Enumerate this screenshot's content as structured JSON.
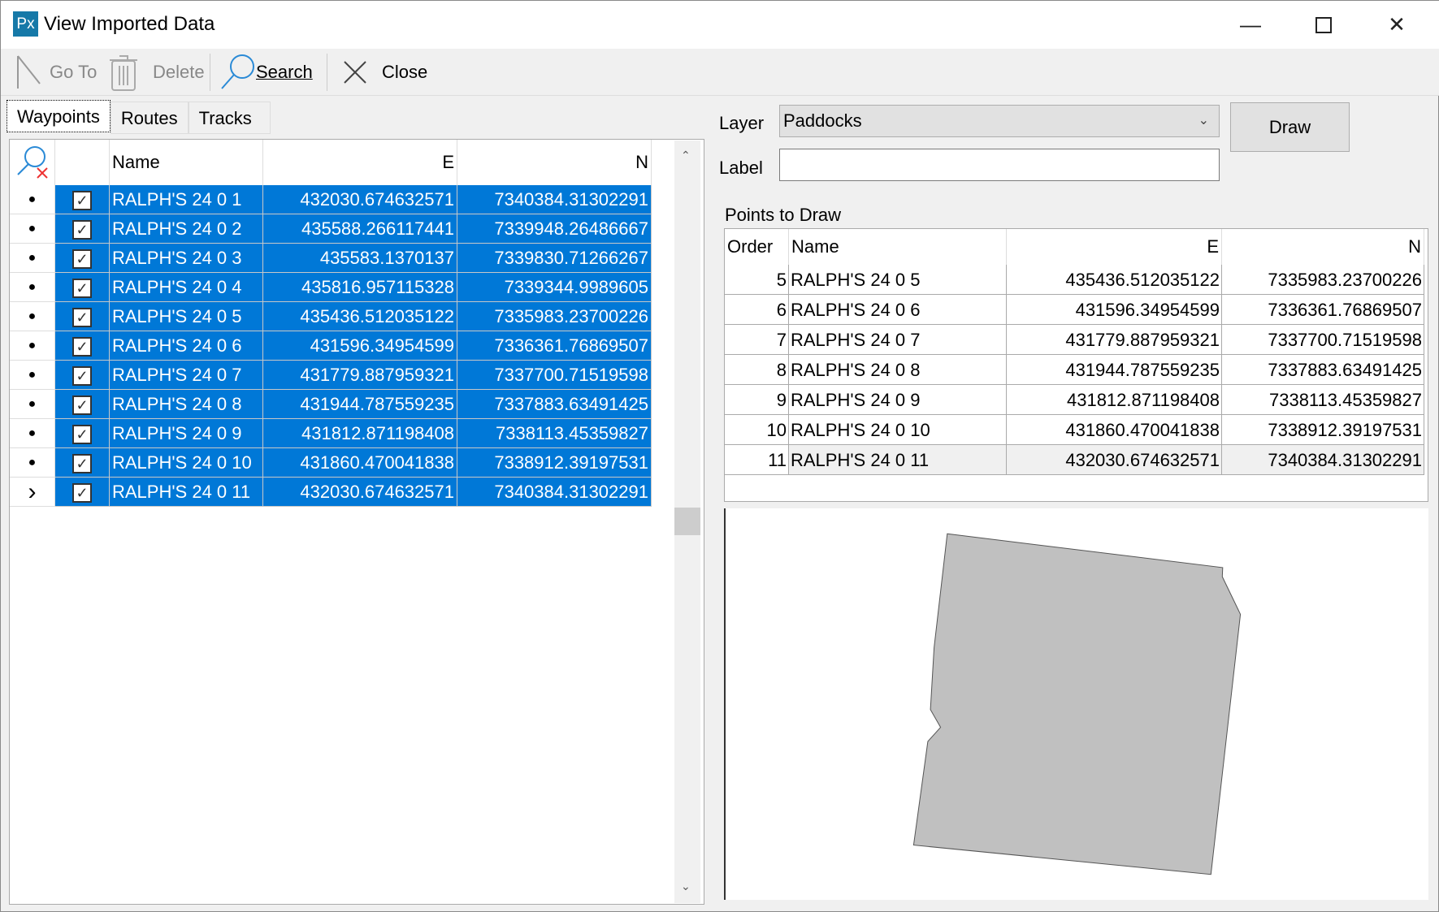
{
  "window": {
    "title": "View Imported Data",
    "app_icon": "Px",
    "controls": [
      "minimize-icon",
      "maximize-icon",
      "close-icon"
    ]
  },
  "toolbar": {
    "goto": "Go To",
    "delete": "Delete",
    "search": "Search",
    "close": "Close"
  },
  "tabs": [
    {
      "label": "Waypoints",
      "active": true
    },
    {
      "label": "Routes"
    },
    {
      "label": "Tracks"
    }
  ],
  "grid": {
    "columns": [
      "Name",
      "E",
      "N"
    ],
    "rows": [
      {
        "name": "RALPH'S 24 0 1",
        "e": "432030.674632571",
        "n": "7340384.31302291",
        "checked": true
      },
      {
        "name": "RALPH'S 24 0 2",
        "e": "435588.266117441",
        "n": "7339948.26486667",
        "checked": true
      },
      {
        "name": "RALPH'S 24 0 3",
        "e": "435583.1370137",
        "n": "7339830.71266267",
        "checked": true
      },
      {
        "name": "RALPH'S 24 0 4",
        "e": "435816.957115328",
        "n": "7339344.9989605",
        "checked": true
      },
      {
        "name": "RALPH'S 24 0 5",
        "e": "435436.512035122",
        "n": "7335983.23700226",
        "checked": true
      },
      {
        "name": "RALPH'S 24 0 6",
        "e": "431596.34954599",
        "n": "7336361.76869507",
        "checked": true
      },
      {
        "name": "RALPH'S 24 0 7",
        "e": "431779.887959321",
        "n": "7337700.71519598",
        "checked": true
      },
      {
        "name": "RALPH'S 24 0 8",
        "e": "431944.787559235",
        "n": "7337883.63491425",
        "checked": true
      },
      {
        "name": "RALPH'S 24 0 9",
        "e": "431812.871198408",
        "n": "7338113.45359827",
        "checked": true
      },
      {
        "name": "RALPH'S 24 0 10",
        "e": "431860.470041838",
        "n": "7338912.39197531",
        "checked": true
      },
      {
        "name": "RALPH'S 24 0 11",
        "e": "432030.674632571",
        "n": "7340384.31302291",
        "checked": true,
        "current": true
      }
    ]
  },
  "form": {
    "layer_label": "Layer",
    "layer_value": "Paddocks",
    "label_label": "Label",
    "label_value": "",
    "draw": "Draw"
  },
  "points": {
    "title": "Points to Draw",
    "columns": [
      "Order",
      "Name",
      "E",
      "N"
    ],
    "rows": [
      {
        "order": "5",
        "name": "RALPH'S 24 0 5",
        "e": "435436.512035122",
        "n": "7335983.23700226"
      },
      {
        "order": "6",
        "name": "RALPH'S 24 0 6",
        "e": "431596.34954599",
        "n": "7336361.76869507"
      },
      {
        "order": "7",
        "name": "RALPH'S 24 0 7",
        "e": "431779.887959321",
        "n": "7337700.71519598"
      },
      {
        "order": "8",
        "name": "RALPH'S 24 0 8",
        "e": "431944.787559235",
        "n": "7337883.63491425"
      },
      {
        "order": "9",
        "name": "RALPH'S 24 0 9",
        "e": "431812.871198408",
        "n": "7338113.45359827"
      },
      {
        "order": "10",
        "name": "RALPH'S 24 0 10",
        "e": "431860.470041838",
        "n": "7338912.39197531"
      },
      {
        "order": "11",
        "name": "RALPH'S 24 0 11",
        "e": "432030.674632571",
        "n": "7340384.31302291",
        "current": true
      }
    ]
  },
  "colors": {
    "selection": "#0078d7",
    "polygon_fill": "#c0c0c0",
    "app_icon": "#1679a8"
  }
}
